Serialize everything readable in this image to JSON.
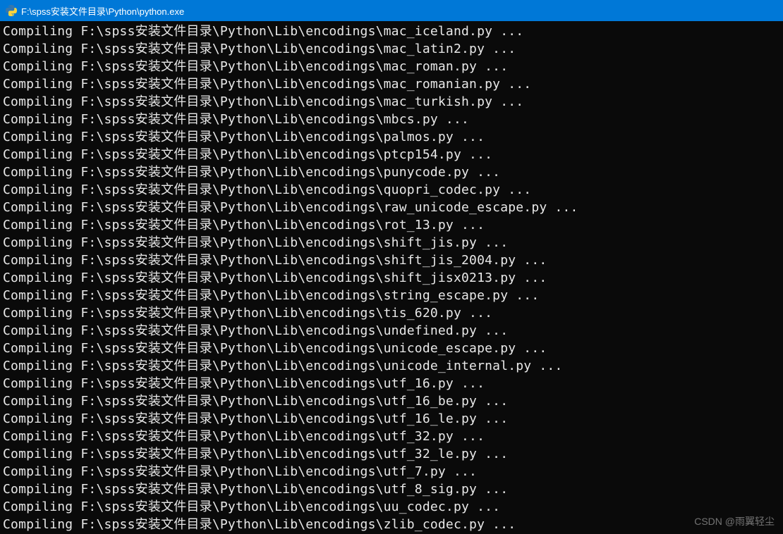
{
  "window": {
    "title": "F:\\spss安装文件目录\\Python\\python.exe"
  },
  "console": {
    "prefix": "Compiling ",
    "base_path": "F:\\spss安装文件目录\\Python\\Lib\\encodings\\",
    "suffix": " ...",
    "files": [
      "mac_iceland.py",
      "mac_latin2.py",
      "mac_roman.py",
      "mac_romanian.py",
      "mac_turkish.py",
      "mbcs.py",
      "palmos.py",
      "ptcp154.py",
      "punycode.py",
      "quopri_codec.py",
      "raw_unicode_escape.py",
      "rot_13.py",
      "shift_jis.py",
      "shift_jis_2004.py",
      "shift_jisx0213.py",
      "string_escape.py",
      "tis_620.py",
      "undefined.py",
      "unicode_escape.py",
      "unicode_internal.py",
      "utf_16.py",
      "utf_16_be.py",
      "utf_16_le.py",
      "utf_32.py",
      "utf_32_le.py",
      "utf_7.py",
      "utf_8_sig.py",
      "uu_codec.py",
      "zlib_codec.py"
    ]
  },
  "watermark": "CSDN @雨翼轻尘"
}
